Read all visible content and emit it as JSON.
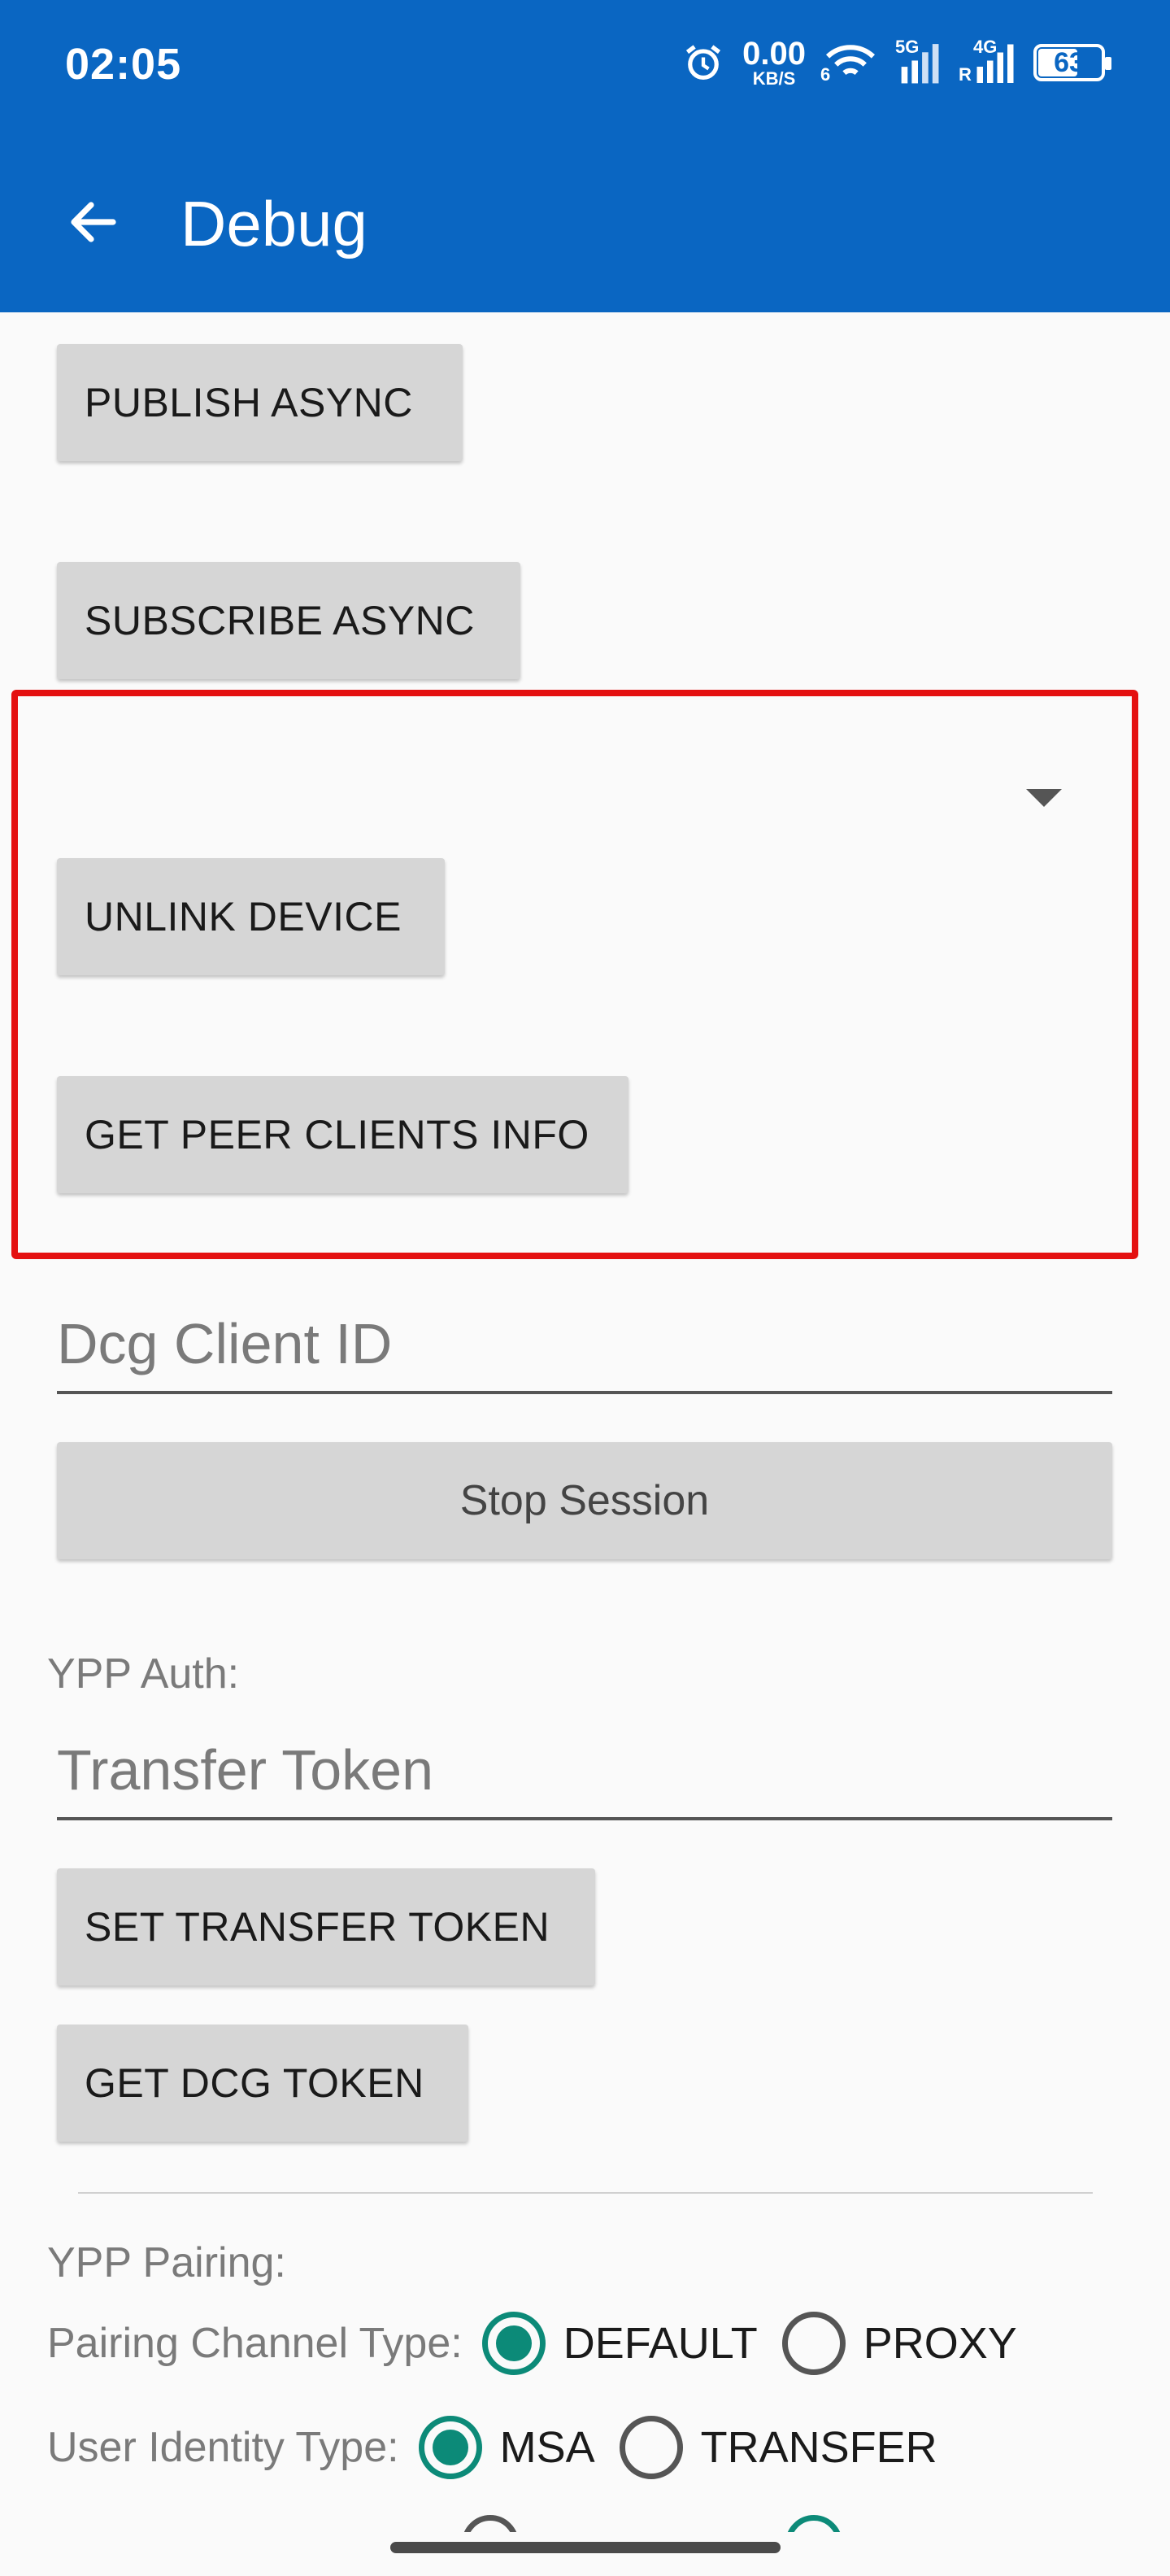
{
  "status_bar": {
    "time": "02:05",
    "net_speed_value": "0.00",
    "net_speed_unit": "KB/S",
    "wifi_tag": "6",
    "sim1_tag": "5G",
    "sim2_tag": "4G",
    "sim2_roaming": "R",
    "battery": "63",
    "icons": [
      "alarm-icon",
      "wifi-icon",
      "signal-icon",
      "signal-icon",
      "battery-icon"
    ]
  },
  "app_bar": {
    "title": "Debug",
    "back_icon": "arrow-left-icon"
  },
  "buttons": {
    "publish_async": "PUBLISH ASYNC",
    "subscribe_async": "SUBSCRIBE ASYNC",
    "unlink_device": "UNLINK DEVICE",
    "get_peer_clients_info": "GET PEER CLIENTS INFO",
    "stop_session": "Stop Session",
    "set_transfer_token": "SET TRANSFER TOKEN",
    "get_dcg_token": "GET DCG TOKEN"
  },
  "inputs": {
    "dcg_client_id_placeholder": "Dcg Client ID",
    "transfer_token_placeholder": "Transfer Token"
  },
  "sections": {
    "ypp_auth": "YPP Auth:",
    "ypp_pairing": "YPP Pairing:"
  },
  "pairing_channel": {
    "label": "Pairing Channel Type:",
    "options": [
      "DEFAULT",
      "PROXY"
    ],
    "selected": "DEFAULT"
  },
  "user_identity": {
    "label": "User Identity Type:",
    "options": [
      "MSA",
      "TRANSFER"
    ],
    "selected": "MSA"
  },
  "colors": {
    "app_bar": "#0a66c2",
    "accent": "#0c8a78",
    "highlight": "#e41010"
  }
}
